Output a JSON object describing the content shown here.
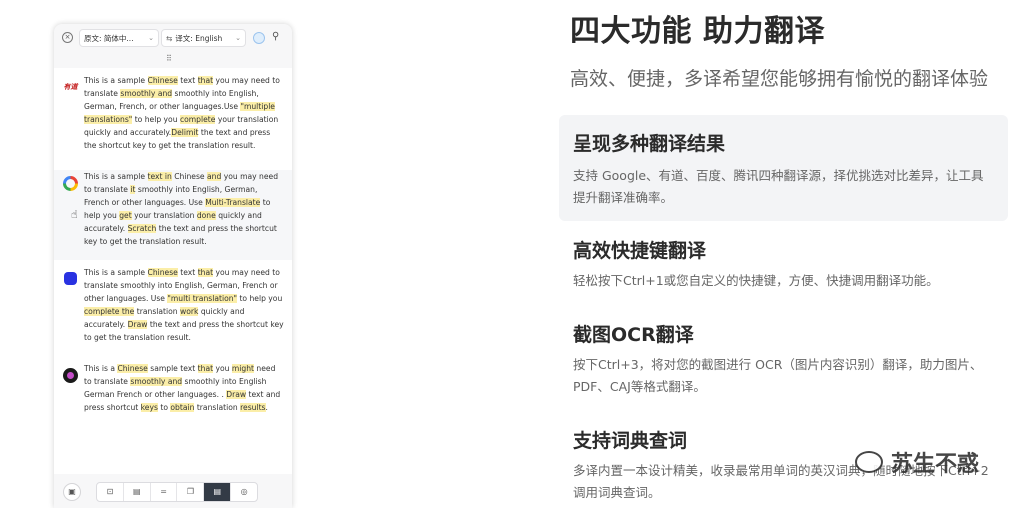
{
  "translator": {
    "close_glyph": "×",
    "source_lang_label": "原文:",
    "source_lang_value": "简体中...",
    "target_lang_label": "译文:",
    "target_lang_value": "English",
    "caret": "⌄",
    "swap_glyph": "⇆",
    "drag_handle": "⠿",
    "results": [
      {
        "source": "youdao",
        "logo_text": "有道",
        "segments": [
          {
            "t": "This is a sample ",
            "h": false
          },
          {
            "t": "Chinese",
            "h": true
          },
          {
            "t": " text ",
            "h": false
          },
          {
            "t": "that",
            "h": true
          },
          {
            "t": " you may need to translate ",
            "h": false
          },
          {
            "t": "smoothly and",
            "h": true
          },
          {
            "t": " smoothly into English, German, French, or other languages.Use ",
            "h": false
          },
          {
            "t": "\"multiple translations\"",
            "h": true
          },
          {
            "t": " to help you ",
            "h": false
          },
          {
            "t": "complete",
            "h": true
          },
          {
            "t": " your translation quickly and accurately.",
            "h": false
          },
          {
            "t": "Delimit",
            "h": true
          },
          {
            "t": " the text and press the shortcut key to get the translation result.",
            "h": false
          }
        ]
      },
      {
        "source": "google",
        "logo_text": "",
        "segments": [
          {
            "t": "This is a sample ",
            "h": false
          },
          {
            "t": "text in",
            "h": true
          },
          {
            "t": " Chinese ",
            "h": false
          },
          {
            "t": "and",
            "h": true
          },
          {
            "t": " you may need to translate ",
            "h": false
          },
          {
            "t": "it",
            "h": true
          },
          {
            "t": " smoothly into English, German, French or other languages. Use ",
            "h": false
          },
          {
            "t": "Multi-Translate",
            "h": true
          },
          {
            "t": " to help you ",
            "h": false
          },
          {
            "t": "get",
            "h": true
          },
          {
            "t": " your translation ",
            "h": false
          },
          {
            "t": "done",
            "h": true
          },
          {
            "t": " quickly and accurately. ",
            "h": false
          },
          {
            "t": "Scratch",
            "h": true
          },
          {
            "t": " the text and press the shortcut key to get the translation result.",
            "h": false
          }
        ]
      },
      {
        "source": "baidu",
        "logo_text": "",
        "segments": [
          {
            "t": "This is a sample ",
            "h": false
          },
          {
            "t": "Chinese",
            "h": true
          },
          {
            "t": " text ",
            "h": false
          },
          {
            "t": "that",
            "h": true
          },
          {
            "t": " you may need to translate smoothly into English, German, French or other languages. Use ",
            "h": false
          },
          {
            "t": "\"multi translation\"",
            "h": true
          },
          {
            "t": " to help you ",
            "h": false
          },
          {
            "t": "complete the",
            "h": true
          },
          {
            "t": " translation ",
            "h": false
          },
          {
            "t": "work",
            "h": true
          },
          {
            "t": " quickly and accurately. ",
            "h": false
          },
          {
            "t": "Draw",
            "h": true
          },
          {
            "t": " the text and press the shortcut key to get the translation result.",
            "h": false
          }
        ]
      },
      {
        "source": "tencent",
        "logo_text": "",
        "segments": [
          {
            "t": "This is a ",
            "h": false
          },
          {
            "t": "Chinese",
            "h": true
          },
          {
            "t": " sample text ",
            "h": false
          },
          {
            "t": "that",
            "h": true
          },
          {
            "t": " you ",
            "h": false
          },
          {
            "t": "might",
            "h": true
          },
          {
            "t": " need to translate ",
            "h": false
          },
          {
            "t": "smoothly and",
            "h": true
          },
          {
            "t": " smoothly into English German French or other languages. . ",
            "h": false
          },
          {
            "t": "Draw",
            "h": true
          },
          {
            "t": " text and press shortcut ",
            "h": false
          },
          {
            "t": "keys",
            "h": true
          },
          {
            "t": " to ",
            "h": false
          },
          {
            "t": "obtain",
            "h": true
          },
          {
            "t": " translation ",
            "h": false
          },
          {
            "t": "results",
            "h": true
          },
          {
            "t": ".",
            "h": false
          }
        ]
      }
    ],
    "toolbar_icons": [
      "stop-icon",
      "clipboard-icon",
      "menu-icon",
      "copy-icon",
      "document-icon",
      "eye-off-icon"
    ],
    "toolbar_glyphs": [
      "⊡",
      "▤",
      "=",
      "❐",
      "▤",
      "◎"
    ],
    "active_tool_index": 4,
    "screenshot_glyph": "▣"
  },
  "page": {
    "title": "四大功能 助力翻译",
    "subtitle": "高效、便捷，多译希望您能够拥有愉悦的翻译体验",
    "features": [
      {
        "title": "呈现多种翻译结果",
        "desc": "支持 Google、有道、百度、腾讯四种翻译源，择优挑选对比差异，让工具提升翻译准确率。"
      },
      {
        "title": "高效快捷键翻译",
        "desc": "轻松按下Ctrl+1或您自定义的快捷键，方便、快捷调用翻译功能。"
      },
      {
        "title": "截图OCR翻译",
        "desc": "按下Ctrl+3，将对您的截图进行 OCR（图片内容识别）翻译，助力图片、PDF、CAJ等格式翻译。"
      },
      {
        "title": "支持词典查词",
        "desc": "多译内置一本设计精美，收录最常用单词的英汉词典，随时随地按下Ctrl+2调用词典查词。"
      }
    ],
    "active_feature_index": 0
  },
  "watermark": {
    "text": "苏生不惑"
  }
}
